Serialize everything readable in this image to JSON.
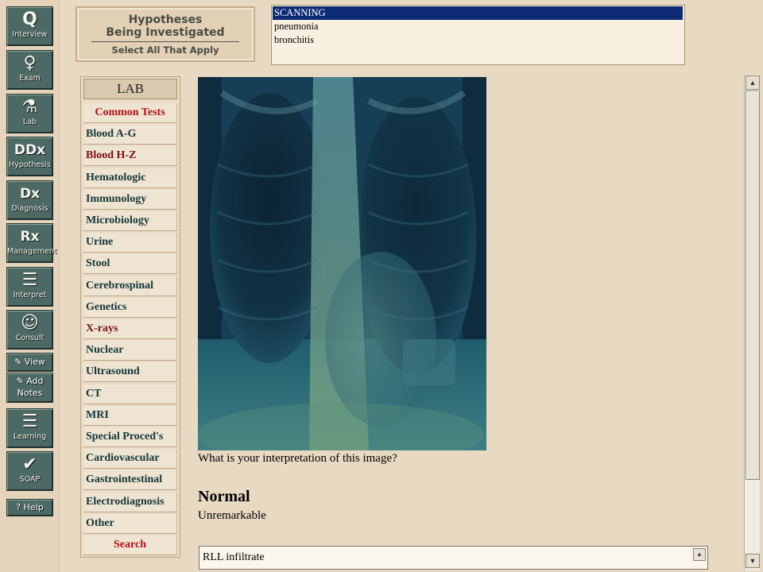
{
  "rail": {
    "tools": [
      {
        "glyph": "Q",
        "label": "Interview"
      },
      {
        "glyph": "♀",
        "label": "Exam"
      },
      {
        "glyph": "⚗",
        "label": "Lab"
      },
      {
        "glyph": "DDx",
        "label": "Hypothesis"
      },
      {
        "glyph": "Dx",
        "label": "Diagnosis"
      },
      {
        "glyph": "Rx",
        "label": "Management"
      },
      {
        "glyph": "☰",
        "label": "Interpret"
      },
      {
        "glyph": "☺",
        "label": "Consult"
      }
    ],
    "view_label": "View",
    "add_label": "Add",
    "notes_label": "Notes",
    "learning_label": "Learning",
    "soap_label": "SOAP",
    "help_label": "? Help"
  },
  "hypotheses": {
    "title_line1": "Hypotheses",
    "title_line2": "Being Investigated",
    "subtitle": "Select All That Apply",
    "items": [
      "SCANNING",
      "pneumonia",
      "bronchitis"
    ],
    "selected_index": 0,
    "selected_color": "#0d2b75"
  },
  "lab": {
    "title": "LAB",
    "items": [
      {
        "label": "Common Tests",
        "color": "#b3121b"
      },
      {
        "label": "Blood A-G",
        "color": "#13363a"
      },
      {
        "label": "Blood H-Z",
        "color": "#7a0f12"
      },
      {
        "label": "Hematologic",
        "color": "#13363a"
      },
      {
        "label": "Immunology",
        "color": "#13363a"
      },
      {
        "label": "Microbiology",
        "color": "#13363a"
      },
      {
        "label": "Urine",
        "color": "#13363a"
      },
      {
        "label": "Stool",
        "color": "#13363a"
      },
      {
        "label": "Cerebrospinal",
        "color": "#13363a"
      },
      {
        "label": "Genetics",
        "color": "#13363a"
      },
      {
        "label": "X-rays",
        "color": "#7a0f12"
      },
      {
        "label": "Nuclear",
        "color": "#13363a"
      },
      {
        "label": "Ultrasound",
        "color": "#13363a"
      },
      {
        "label": "CT",
        "color": "#13363a"
      },
      {
        "label": "MRI",
        "color": "#13363a"
      },
      {
        "label": "Special Proced's",
        "color": "#13363a"
      },
      {
        "label": "Cardiovascular",
        "color": "#13363a"
      },
      {
        "label": "Gastrointestinal",
        "color": "#13363a"
      },
      {
        "label": "Electrodiagnosis",
        "color": "#13363a"
      },
      {
        "label": "Other",
        "color": "#13363a"
      },
      {
        "label": "Search",
        "color": "#b3121b"
      }
    ]
  },
  "viewer": {
    "question": "What is your interpretation of this image?",
    "result_title": "Normal",
    "result_desc": "Unremarkable",
    "interpretation_value": "RLL infiltrate"
  }
}
